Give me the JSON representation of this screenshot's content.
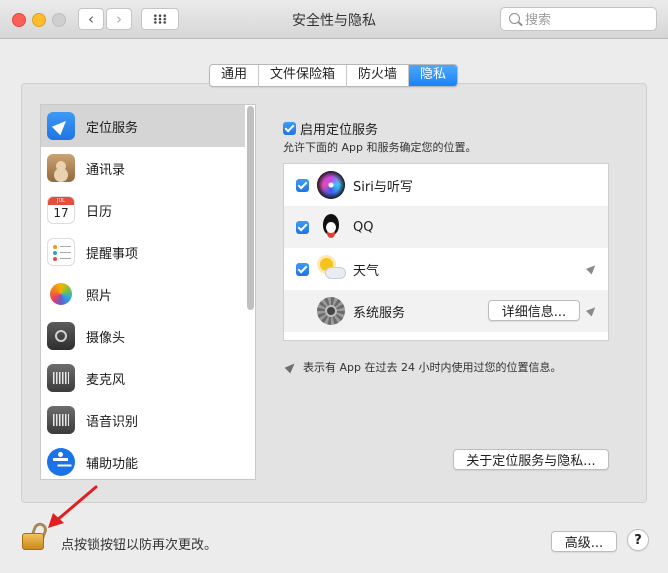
{
  "window": {
    "title": "安全性与隐私",
    "search_placeholder": "搜索",
    "back_icon": "chevron-left-icon",
    "forward_icon": "chevron-right-icon",
    "grid_icon": "grid-icon"
  },
  "tabs": [
    {
      "label": "通用",
      "active": false
    },
    {
      "label": "文件保险箱",
      "active": false
    },
    {
      "label": "防火墙",
      "active": false
    },
    {
      "label": "隐私",
      "active": true
    }
  ],
  "sidebar": {
    "items": [
      {
        "label": "定位服务",
        "icon": "location-icon",
        "selected": true
      },
      {
        "label": "通讯录",
        "icon": "contacts-icon"
      },
      {
        "label": "日历",
        "icon": "calendar-icon",
        "icon_month": "JUL",
        "icon_day": "17"
      },
      {
        "label": "提醒事项",
        "icon": "reminders-icon"
      },
      {
        "label": "照片",
        "icon": "photos-icon"
      },
      {
        "label": "摄像头",
        "icon": "camera-icon"
      },
      {
        "label": "麦克风",
        "icon": "microphone-icon"
      },
      {
        "label": "语音识别",
        "icon": "speech-recognition-icon"
      },
      {
        "label": "辅助功能",
        "icon": "accessibility-icon"
      }
    ]
  },
  "location": {
    "enable_label": "启用定位服务",
    "enabled": true,
    "description": "允许下面的 App 和服务确定您的位置。",
    "apps": [
      {
        "name": "Siri与听写",
        "checked": true,
        "icon": "siri-icon",
        "recent": false
      },
      {
        "name": "QQ",
        "checked": true,
        "icon": "qq-icon",
        "recent": false
      },
      {
        "name": "天气",
        "checked": true,
        "icon": "weather-icon",
        "recent": true
      },
      {
        "name": "系统服务",
        "icon": "system-services-icon",
        "details_label": "详细信息...",
        "recent": true
      }
    ],
    "hint": "表示有 App 在过去 24 小时内使用过您的位置信息。",
    "about_label": "关于定位服务与隐私..."
  },
  "footer": {
    "lock_message": "点按锁按钮以防再次更改。",
    "advanced_label": "高级...",
    "help_label": "?"
  },
  "colors": {
    "accent": "#1a82f8",
    "annotation_arrow": "#e02020"
  }
}
